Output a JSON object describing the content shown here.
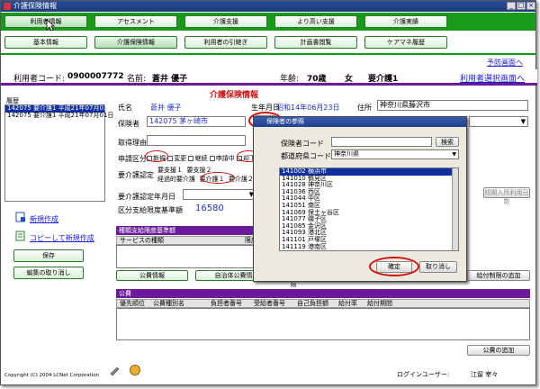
{
  "window": {
    "title": "介護保険情報"
  },
  "menu_row1": [
    {
      "label": "利用者情報"
    },
    {
      "label": "アセスメント"
    },
    {
      "label": "介護支援"
    },
    {
      "label": "より高い支援"
    },
    {
      "label": "介護実績"
    }
  ],
  "menu_row2": [
    {
      "label": "基本情報"
    },
    {
      "label": "介護保険情報"
    },
    {
      "label": "利用者の引継ぎ"
    },
    {
      "label": "計画書閲覧"
    },
    {
      "label": "ケアマネ履歴"
    }
  ],
  "links": {
    "prev_screen": "予防画面へ",
    "user_select": "利用者選択画面へ"
  },
  "user_bar": {
    "code_label": "利用者コード:",
    "code": "0900007772",
    "name_label": "名前:",
    "name": "蒼井 優子",
    "age_label": "年齢:",
    "age": "70歳",
    "sex": "女",
    "care_level": "要介護1"
  },
  "history": {
    "label": "履歴",
    "items": [
      "142075 要介護1 平成21年07月01日",
      "142075 要介護1 平成21年07月01日"
    ]
  },
  "left_actions": {
    "new": "新規作成",
    "copy_new": "コピーして新規作成",
    "save": "保存",
    "cancel_edit": "編集の取り消し"
  },
  "form": {
    "section_title": "介護保険情報",
    "name_label": "氏名",
    "name_value": "蒼井 優子",
    "dob_label": "生年月日",
    "dob_value": "昭和14年06月23日",
    "address_label": "住所",
    "address_value": "神奈川県藤沢市",
    "insurer_label": "保険者",
    "insurer_code": "142075",
    "insurer_name": "茅ヶ崎市",
    "ref_button": "参照",
    "reason_label": "取得理由",
    "qualification_label": "資格",
    "apply_label": "申請区分",
    "apply_options": [
      "新規",
      "変更",
      "継続",
      "申請中",
      "却下",
      "経"
    ],
    "cert_label": "要介護認定",
    "cert_options": [
      "要支援１",
      "要支援２",
      "経過的要介護",
      "要介護１",
      "要介護２"
    ],
    "cert_date_label": "要介護認定年月日",
    "valid_label": "有効",
    "limit_label": "区分支給限度基準額",
    "limit_value": "16580",
    "short_stay_btn": "短期入所利用日数"
  },
  "service_section": {
    "title": "種類支給限度基準額",
    "col1": "サービスの種類",
    "col2": "限度額"
  },
  "tabs": {
    "insurance": "公費情報",
    "local": "自治体公費情報",
    "sub": "支給制限",
    "add_limit": "給付制限の追加"
  },
  "public_section": {
    "title": "公費",
    "cols": [
      "優先順位",
      "公費種別名",
      "負担者番号",
      "受給者番号",
      "自己負担額",
      "給付率",
      "給付期間"
    ],
    "add": "公費の追加"
  },
  "footer": {
    "copyright": "Copyright (C) 2004 LCNet Corporation",
    "login_label": "ログインユーザー:",
    "login_user": "江留 宰々"
  },
  "dialog": {
    "title": "保険者の参照",
    "insurer_code_label": "保険者コード",
    "search": "検索",
    "pref_label": "都道府県コード",
    "pref_value": "神奈川県",
    "items": [
      "141002 横浜市",
      "141010 鶴見区",
      "141028 神奈川区",
      "141036 西区",
      "141044 中区",
      "141051 南区",
      "141069 保土ヶ谷区",
      "141077 磯子区",
      "141085 金沢区",
      "141093 港北区",
      "141101 戸塚区",
      "141119 港南区"
    ],
    "ok": "確定",
    "cancel": "取り消し"
  },
  "colors": {
    "green": "#1a9a1a",
    "purple": "#6a1a9a",
    "highlight": "#d01010"
  }
}
